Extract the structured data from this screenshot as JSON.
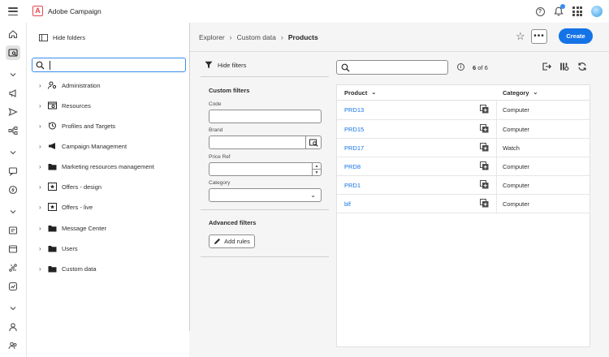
{
  "app": {
    "title": "Adobe Campaign"
  },
  "folders": {
    "hide_label": "Hide folders",
    "search_placeholder": "",
    "items": [
      {
        "label": "Administration",
        "icon": "admin-icon"
      },
      {
        "label": "Resources",
        "icon": "resources-icon"
      },
      {
        "label": "Profiles and Targets",
        "icon": "profiles-icon"
      },
      {
        "label": "Campaign Management",
        "icon": "megaphone-icon"
      },
      {
        "label": "Marketing resources management",
        "icon": "folder-icon"
      },
      {
        "label": "Offers - design",
        "icon": "offer-icon"
      },
      {
        "label": "Offers - live",
        "icon": "offer-icon"
      },
      {
        "label": "Message Center",
        "icon": "folder-icon"
      },
      {
        "label": "Users",
        "icon": "folder-icon"
      },
      {
        "label": "Custom data",
        "icon": "folder-icon"
      }
    ]
  },
  "breadcrumb": {
    "root": "Explorer",
    "parent": "Custom data",
    "current": "Products"
  },
  "actions": {
    "more": "•••",
    "create": "Create"
  },
  "filters": {
    "hide_label": "Hide filters",
    "custom_title": "Custom filters",
    "code_label": "Code",
    "brand_label": "Brand",
    "price_label": "Price Ref",
    "category_label": "Category",
    "advanced_title": "Advanced filters",
    "add_rules": "Add rules"
  },
  "grid": {
    "count_label": "of 6",
    "count_value": "6",
    "columns": {
      "product": "Product",
      "category": "Category"
    },
    "rows": [
      {
        "product": "PRD13",
        "category": "Computer"
      },
      {
        "product": "PRD15",
        "category": "Computer"
      },
      {
        "product": "PRD17",
        "category": "Watch"
      },
      {
        "product": "PRD8",
        "category": "Computer"
      },
      {
        "product": "PRD1",
        "category": "Computer"
      },
      {
        "product": "blf",
        "category": "Computer"
      }
    ]
  }
}
